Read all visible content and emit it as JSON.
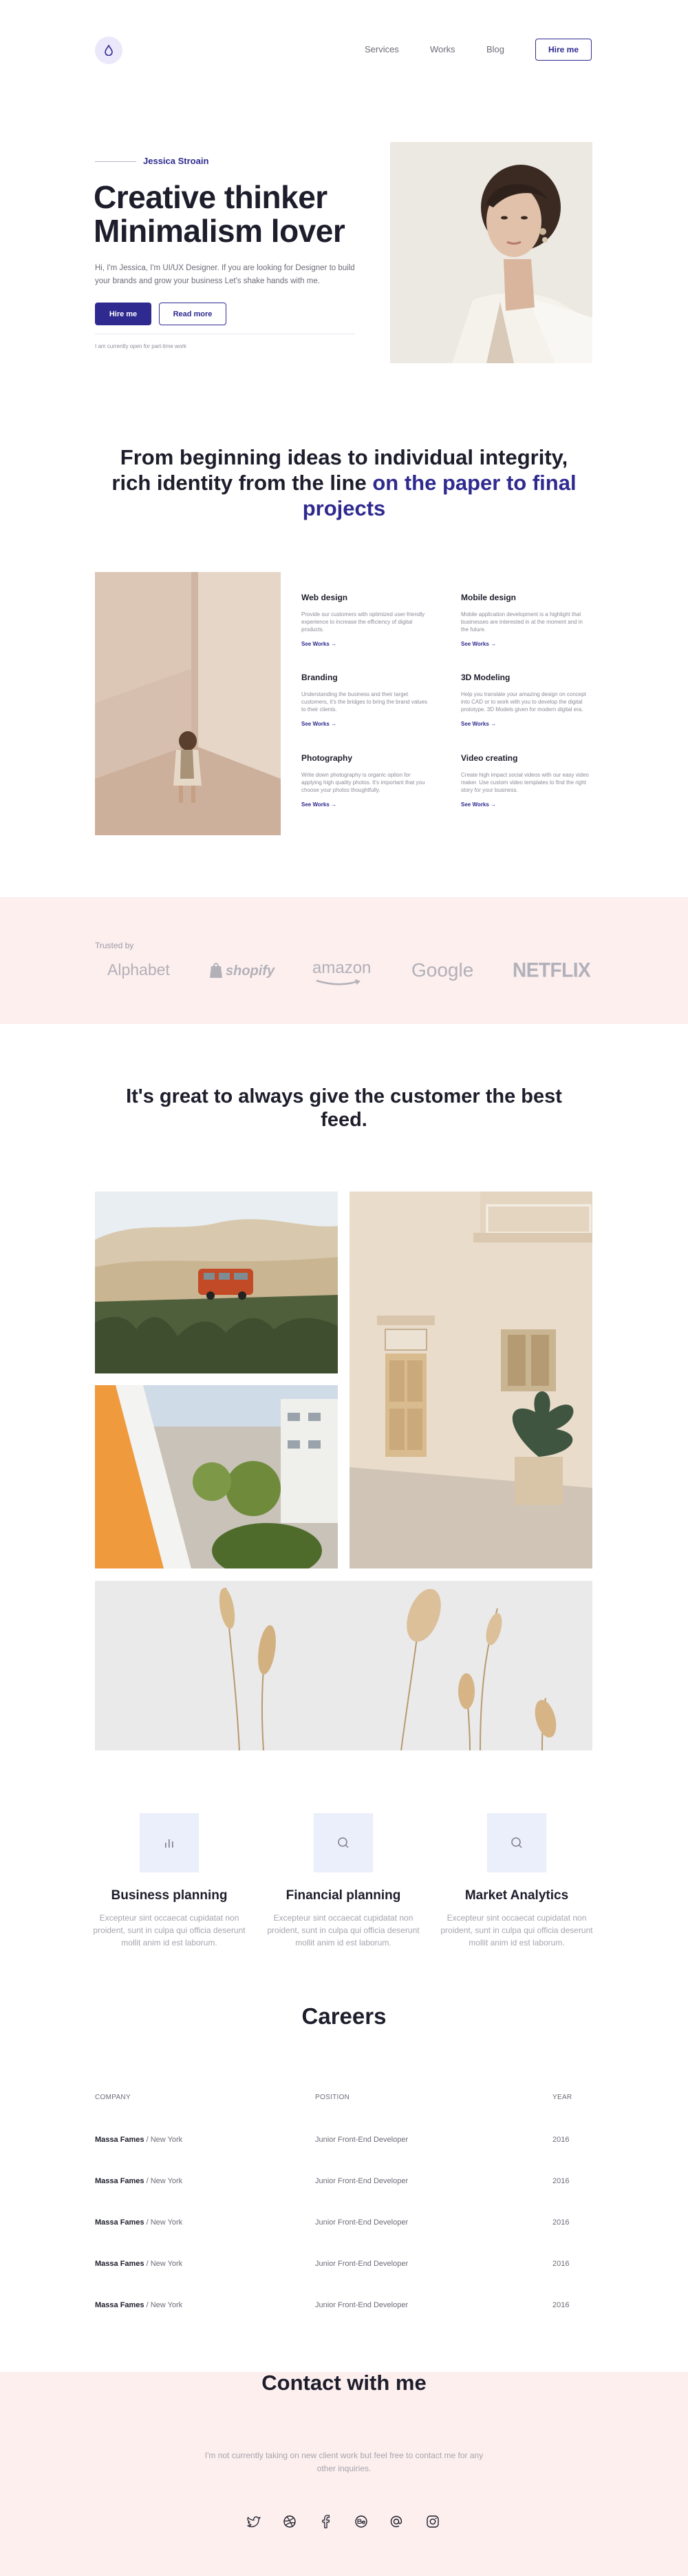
{
  "header": {
    "nav": [
      {
        "label": "Services"
      },
      {
        "label": "Works"
      },
      {
        "label": "Blog"
      }
    ],
    "hire_label": "Hire me"
  },
  "hero": {
    "name": "Jessica Stroain",
    "title_line1": "Creative thinker",
    "title_line2": "Minimalism lover",
    "description": "Hi, I'm Jessica, I'm UI/UX Designer. If you are looking for Designer to build your brands and grow your business Let's shake hands with me.",
    "primary_button": "Hire me",
    "secondary_button": "Read more",
    "note": "I am currently open for part-time work"
  },
  "statement": {
    "text": "From beginning ideas to individual integrity, rich identity from the line ",
    "highlight": "on the paper to final projects"
  },
  "services": [
    {
      "title": "Web design",
      "desc": "Provide our customers with optimized user-friendly experience to increase the efficiency of digital products.",
      "link": "See Works →"
    },
    {
      "title": "Mobile design",
      "desc": "Mobile application development is a highlight that businesses are interested in at the moment and in the future.",
      "link": "See Works →"
    },
    {
      "title": "Branding",
      "desc": "Understanding the business and their target customers, it's the bridges to bring the brand values to their clients.",
      "link": "See Works →"
    },
    {
      "title": "3D Modeling",
      "desc": "Help you translate your amazing design on concept into CAD or to work with you to develop the digital prototype. 3D Models given for modern digital era.",
      "link": "See Works →"
    },
    {
      "title": "Photography",
      "desc": "Write down photography is organic option for applying high quality photos. It's important that you choose your photos thoughtfully.",
      "link": "See Works →"
    },
    {
      "title": "Video creating",
      "desc": "Create high impact social videos with our easy video maker. Use custom video templates to find the right story for your business.",
      "link": "See Works →"
    }
  ],
  "trusted": {
    "label": "Trusted by",
    "brands": [
      "Alphabet",
      "shopify",
      "amazon",
      "Google",
      "NETFLIX"
    ]
  },
  "feedback": {
    "title": "It's great to always give the customer the best feed."
  },
  "features": [
    {
      "icon": "bar-chart-icon",
      "title": "Business planning",
      "desc": "Excepteur sint occaecat cupidatat non proident, sunt in culpa qui officia deserunt mollit anim id est laborum."
    },
    {
      "icon": "search-icon",
      "title": "Financial planning",
      "desc": "Excepteur sint occaecat cupidatat non proident, sunt in culpa qui officia deserunt mollit anim id est laborum."
    },
    {
      "icon": "search-icon",
      "title": "Market Analytics",
      "desc": "Excepteur sint occaecat cupidatat non proident, sunt in culpa qui officia deserunt mollit anim id est laborum."
    }
  ],
  "careers": {
    "title": "Careers",
    "headers": {
      "company": "COMPANY",
      "position": "POSITION",
      "year": "YEAR"
    },
    "rows": [
      {
        "company": "Massa Fames",
        "location": " / New York",
        "position": "Junior Front-End Developer",
        "year": "2016"
      },
      {
        "company": "Massa Fames",
        "location": " / New York",
        "position": "Junior Front-End Developer",
        "year": "2016"
      },
      {
        "company": "Massa Fames",
        "location": " / New York",
        "position": "Junior Front-End Developer",
        "year": "2016"
      },
      {
        "company": "Massa Fames",
        "location": " / New York",
        "position": "Junior Front-End Developer",
        "year": "2016"
      },
      {
        "company": "Massa Fames",
        "location": " / New York",
        "position": "Junior Front-End Developer",
        "year": "2016"
      }
    ]
  },
  "contact": {
    "title": "Contact with me",
    "desc": "I'm not currently taking on new client work but feel free to contact me for any other inquiries.",
    "socials": [
      "twitter-icon",
      "dribbble-icon",
      "facebook-icon",
      "behance-icon",
      "email-at-icon",
      "instagram-icon"
    ]
  },
  "colors": {
    "accent": "#2f2a8f",
    "band": "#fcefee",
    "feature_box": "#ebeefb"
  }
}
